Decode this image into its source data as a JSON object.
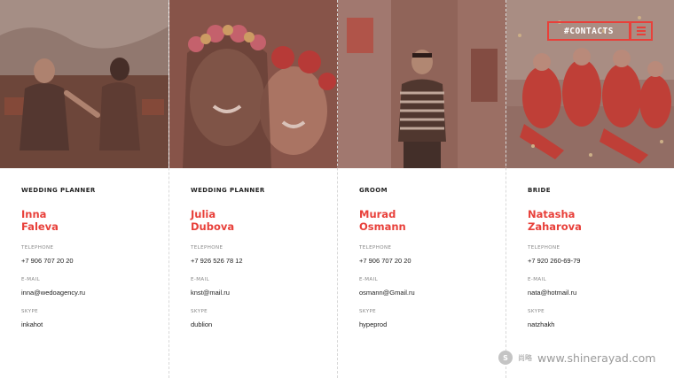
{
  "header": {
    "contacts_label": "#CONTACTS",
    "menu_icon": "hamburger-menu-icon",
    "accent_color": "#e8403a"
  },
  "people": [
    {
      "role": "WEDDING PLANNER",
      "first_name": "Inna",
      "last_name": "Faleva",
      "telephone_label": "TELEPHONE",
      "telephone": "+7 906 707 20 20",
      "email_label": "E-MAIL",
      "email": "inna@wedoagency.ru",
      "skype_label": "SKYPE",
      "skype": "inkahot"
    },
    {
      "role": "WEDDING PLANNER",
      "first_name": "Julia",
      "last_name": "Dubova",
      "telephone_label": "TELEPHONE",
      "telephone": "+7 926 526 78 12",
      "email_label": "E-MAIL",
      "email": "knst@mail.ru",
      "skype_label": "SKYPE",
      "skype": "dublion"
    },
    {
      "role": "GROOM",
      "first_name": "Murad",
      "last_name": "Osmann",
      "telephone_label": "TELEPHONE",
      "telephone": "+7 906 707 20 20",
      "email_label": "E-MAIL",
      "email": "osmann@Gmail.ru",
      "skype_label": "SKYPE",
      "skype": "hypeprod"
    },
    {
      "role": "BRIDE",
      "first_name": "Natasha",
      "last_name": "Zaharova",
      "telephone_label": "TELEPHONE",
      "telephone": "+7 920 260-69-79",
      "email_label": "E-MAIL",
      "email": "nata@hotmail.ru",
      "skype_label": "SKYPE",
      "skype": "natzhakh"
    }
  ],
  "watermark": {
    "logo_glyph": "S",
    "cn_text": "尚略",
    "url": "www.shinerayad.com"
  }
}
